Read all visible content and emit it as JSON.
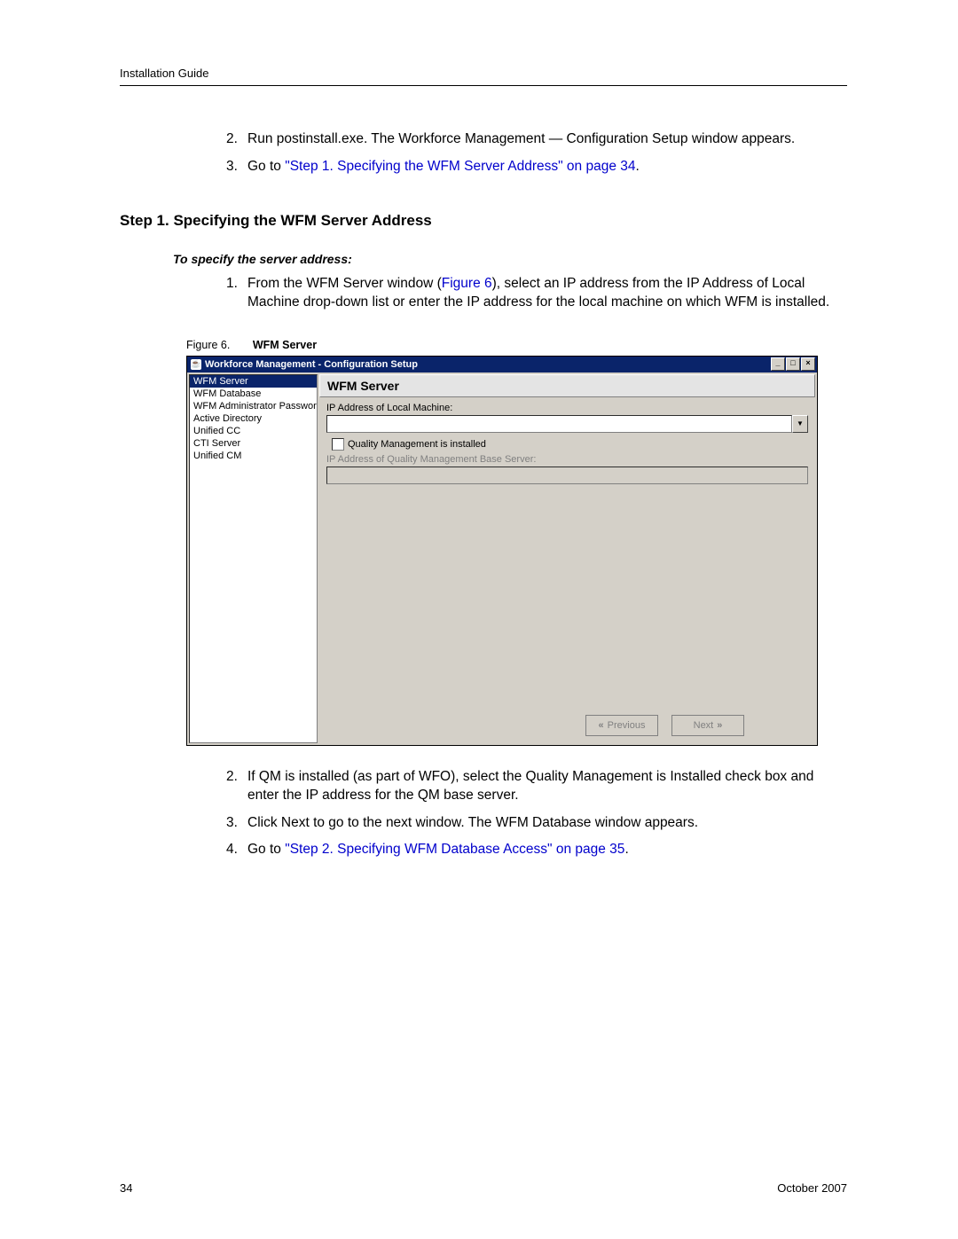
{
  "header": {
    "doc_title": "Installation Guide"
  },
  "list_top": {
    "item2_num": "2.",
    "item2_text": "Run postinstall.exe. The Workforce Management — Configuration Setup window appears.",
    "item3_num": "3.",
    "item3_prefix": "Go to ",
    "item3_link": "\"Step 1. Specifying the WFM Server Address\" on page 34",
    "item3_suffix": "."
  },
  "section_heading": "Step 1. Specifying the WFM Server Address",
  "sub_intro": "To specify the server address:",
  "step1": {
    "num": "1.",
    "prefix": "From the WFM Server window (",
    "figref": "Figure 6",
    "mid": "), select an IP address from the IP Address of Local Machine drop-down list or enter the IP address for the local machine on which WFM is installed."
  },
  "figure": {
    "label": "Figure 6.",
    "title": "WFM Server"
  },
  "window": {
    "title": "Workforce Management - Configuration Setup",
    "nav_items": [
      "WFM Server",
      "WFM Database",
      "WFM Administrator Password",
      "Active Directory",
      "Unified CC",
      "CTI Server",
      "Unified CM"
    ],
    "panel_title": "WFM Server",
    "ip_label": "IP Address of Local Machine:",
    "qm_checkbox_label": "Quality Management is installed",
    "qm_ip_label": "IP Address of Quality Management Base Server:",
    "btn_prev": "Previous",
    "btn_next": "Next"
  },
  "list_bottom": {
    "item2_num": "2.",
    "item2_text": "If QM is installed (as part of WFO), select the Quality Management is Installed check box and enter the IP address for the QM base server.",
    "item3_num": "3.",
    "item3_prefix": "Click ",
    "item3_bold": "Next",
    "item3_suffix": " to go to the next window. The WFM Database window appears.",
    "item4_num": "4.",
    "item4_prefix": "Go to ",
    "item4_link": "\"Step 2. Specifying WFM Database Access\" on page 35",
    "item4_suffix": "."
  },
  "footer": {
    "page_num": "34",
    "date": "October 2007"
  }
}
